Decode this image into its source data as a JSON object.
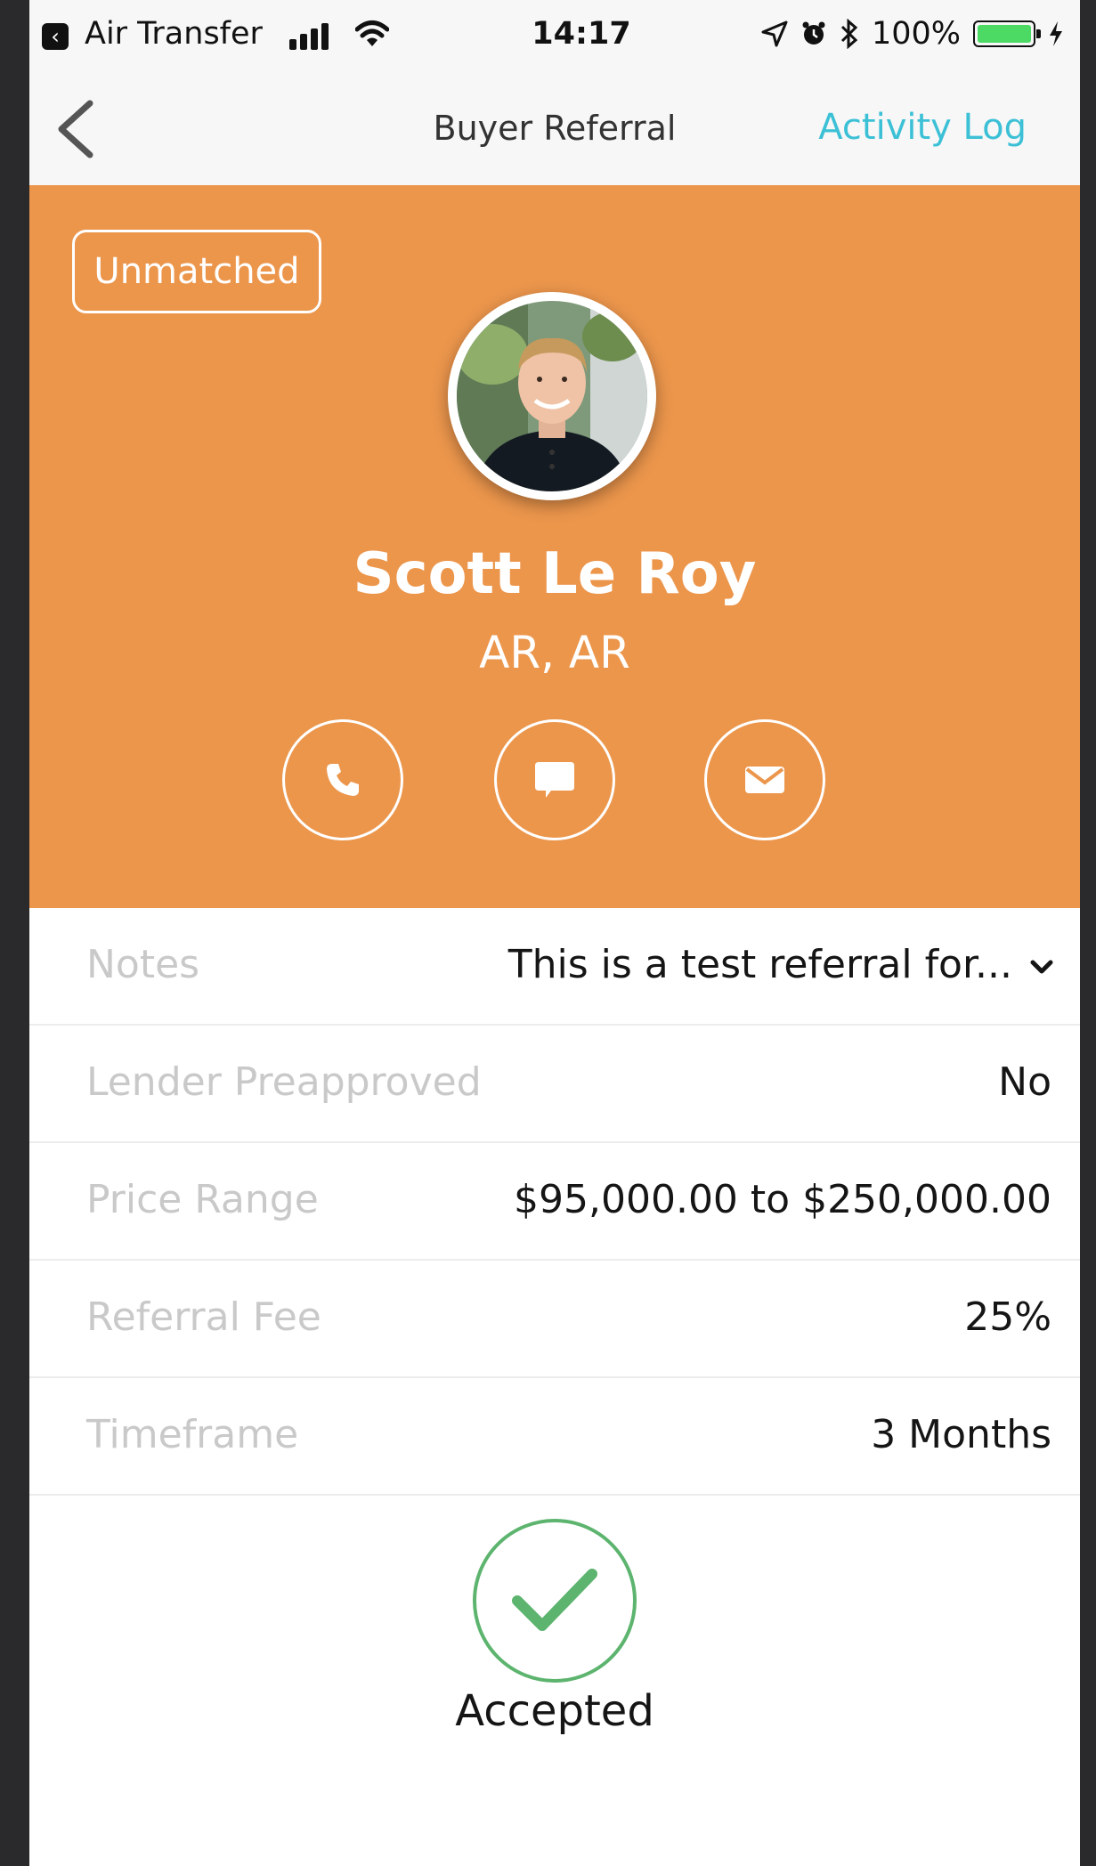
{
  "status_bar": {
    "back_app_label": "Air Transfer",
    "time": "14:17",
    "battery_text": "100%",
    "battery_level": 1.0
  },
  "nav": {
    "title": "Buyer Referral",
    "action": "Activity Log"
  },
  "profile": {
    "status_badge": "Unmatched",
    "name": "Scott Le Roy",
    "location": "AR, AR",
    "actions": [
      "phone-icon",
      "message-icon",
      "mail-icon"
    ]
  },
  "details": [
    {
      "label": "Notes",
      "value": "This is a test referral for..."
    },
    {
      "label": "Lender Preapproved",
      "value": "No"
    },
    {
      "label": "Price Range",
      "value": "$95,000.00 to $250,000.00"
    },
    {
      "label": "Referral Fee",
      "value": "25%"
    },
    {
      "label": "Timeframe",
      "value": "3 Months"
    }
  ],
  "accepted": {
    "label": "Accepted"
  },
  "colors": {
    "header": "#ec964c",
    "accent": "#3cc0d6",
    "success": "#5cb46e"
  }
}
